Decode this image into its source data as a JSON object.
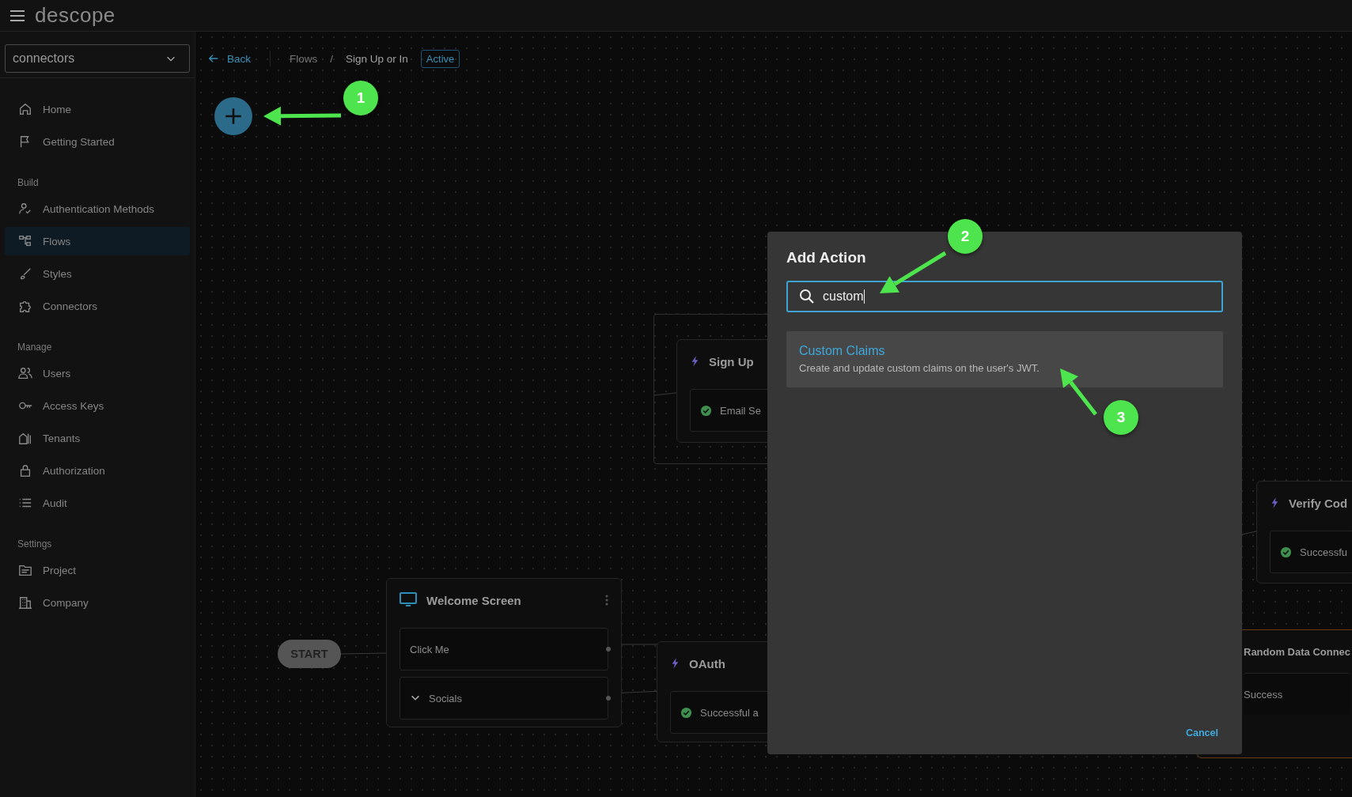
{
  "app": {
    "logo": "descope"
  },
  "project_selector": {
    "value": "connectors"
  },
  "sidebar": {
    "sections": [
      {
        "items": [
          {
            "label": "Home",
            "selected": false
          },
          {
            "label": "Getting Started",
            "selected": false
          }
        ]
      },
      {
        "heading": "Build",
        "items": [
          {
            "label": "Authentication Methods",
            "selected": false
          },
          {
            "label": "Flows",
            "selected": true
          },
          {
            "label": "Styles",
            "selected": false
          },
          {
            "label": "Connectors",
            "selected": false
          }
        ]
      },
      {
        "heading": "Manage",
        "items": [
          {
            "label": "Users",
            "selected": false
          },
          {
            "label": "Access Keys",
            "selected": false
          },
          {
            "label": "Tenants",
            "selected": false
          },
          {
            "label": "Authorization",
            "selected": false
          },
          {
            "label": "Audit",
            "selected": false
          }
        ]
      },
      {
        "heading": "Settings",
        "items": [
          {
            "label": "Project",
            "selected": false
          },
          {
            "label": "Company",
            "selected": false
          }
        ]
      }
    ]
  },
  "breadcrumb": {
    "back": "Back",
    "items": [
      "Flows",
      "Sign Up or In"
    ],
    "separator": "/",
    "status": "Active"
  },
  "canvas": {
    "nodes": [
      {
        "kind": "group"
      },
      {
        "kind": "action",
        "title": "Sign Up",
        "rows": [
          {
            "kind": "outcome",
            "label": "Email Se"
          }
        ]
      },
      {
        "kind": "start",
        "title": "START"
      },
      {
        "kind": "screen",
        "title": "Welcome Screen",
        "rows": [
          {
            "kind": "button",
            "label": "Click Me"
          },
          {
            "kind": "collapsible",
            "label": "Socials"
          }
        ]
      },
      {
        "kind": "action",
        "title": "OAuth",
        "rows": [
          {
            "kind": "outcome",
            "label": "Successful a"
          }
        ]
      },
      {
        "kind": "action",
        "title": "Verify Cod",
        "rows": [
          {
            "kind": "outcome",
            "label": "Successfu"
          }
        ]
      },
      {
        "kind": "connector",
        "title": "Random Data Connec",
        "rows": [
          {
            "kind": "plain",
            "label": "Success"
          }
        ]
      }
    ]
  },
  "dialog": {
    "title": "Add Action",
    "search": {
      "value": "custom"
    },
    "results": [
      {
        "title": "Custom Claims",
        "description": "Create and update custom claims on the user's JWT.",
        "selected": true
      }
    ],
    "cancel": "Cancel"
  },
  "annotations": [
    {
      "number": "1"
    },
    {
      "number": "2"
    },
    {
      "number": "3"
    }
  ]
}
